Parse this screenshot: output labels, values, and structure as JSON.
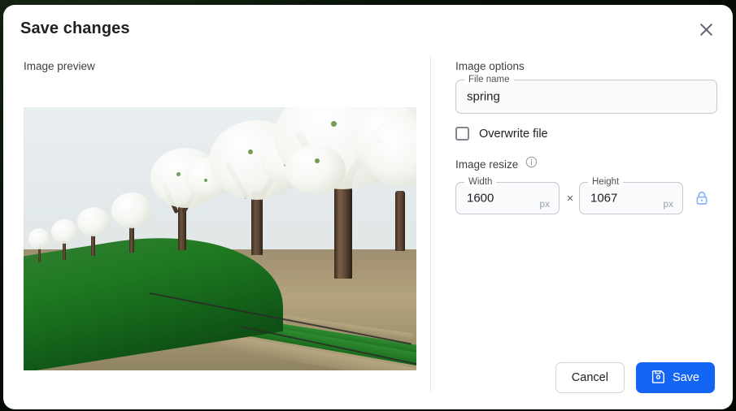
{
  "dialog": {
    "title": "Save changes",
    "close_icon": "close-icon"
  },
  "left": {
    "preview_label": "Image preview",
    "image_alt": "orchard of blossoming white fruit trees with green grass and dirt rows"
  },
  "right": {
    "options_label": "Image options",
    "filename": {
      "label": "File name",
      "value": "spring"
    },
    "overwrite": {
      "label": "Overwrite file",
      "checked": false
    },
    "resize": {
      "label": "Image resize",
      "info_icon": "info-icon",
      "width": {
        "label": "Width",
        "value": "1600",
        "unit": "px"
      },
      "separator": "×",
      "height": {
        "label": "Height",
        "value": "1067",
        "unit": "px"
      },
      "lock_icon": "lock-closed-icon",
      "lock_locked": true
    }
  },
  "footer": {
    "cancel_label": "Cancel",
    "save_label": "Save",
    "save_icon": "save-disk-icon"
  },
  "colors": {
    "accent": "#1565f5",
    "lock": "#8ab4f8",
    "text": "#202124",
    "muted": "#5f6368",
    "border": "#c6cace",
    "backdrop": "#1d3327"
  }
}
